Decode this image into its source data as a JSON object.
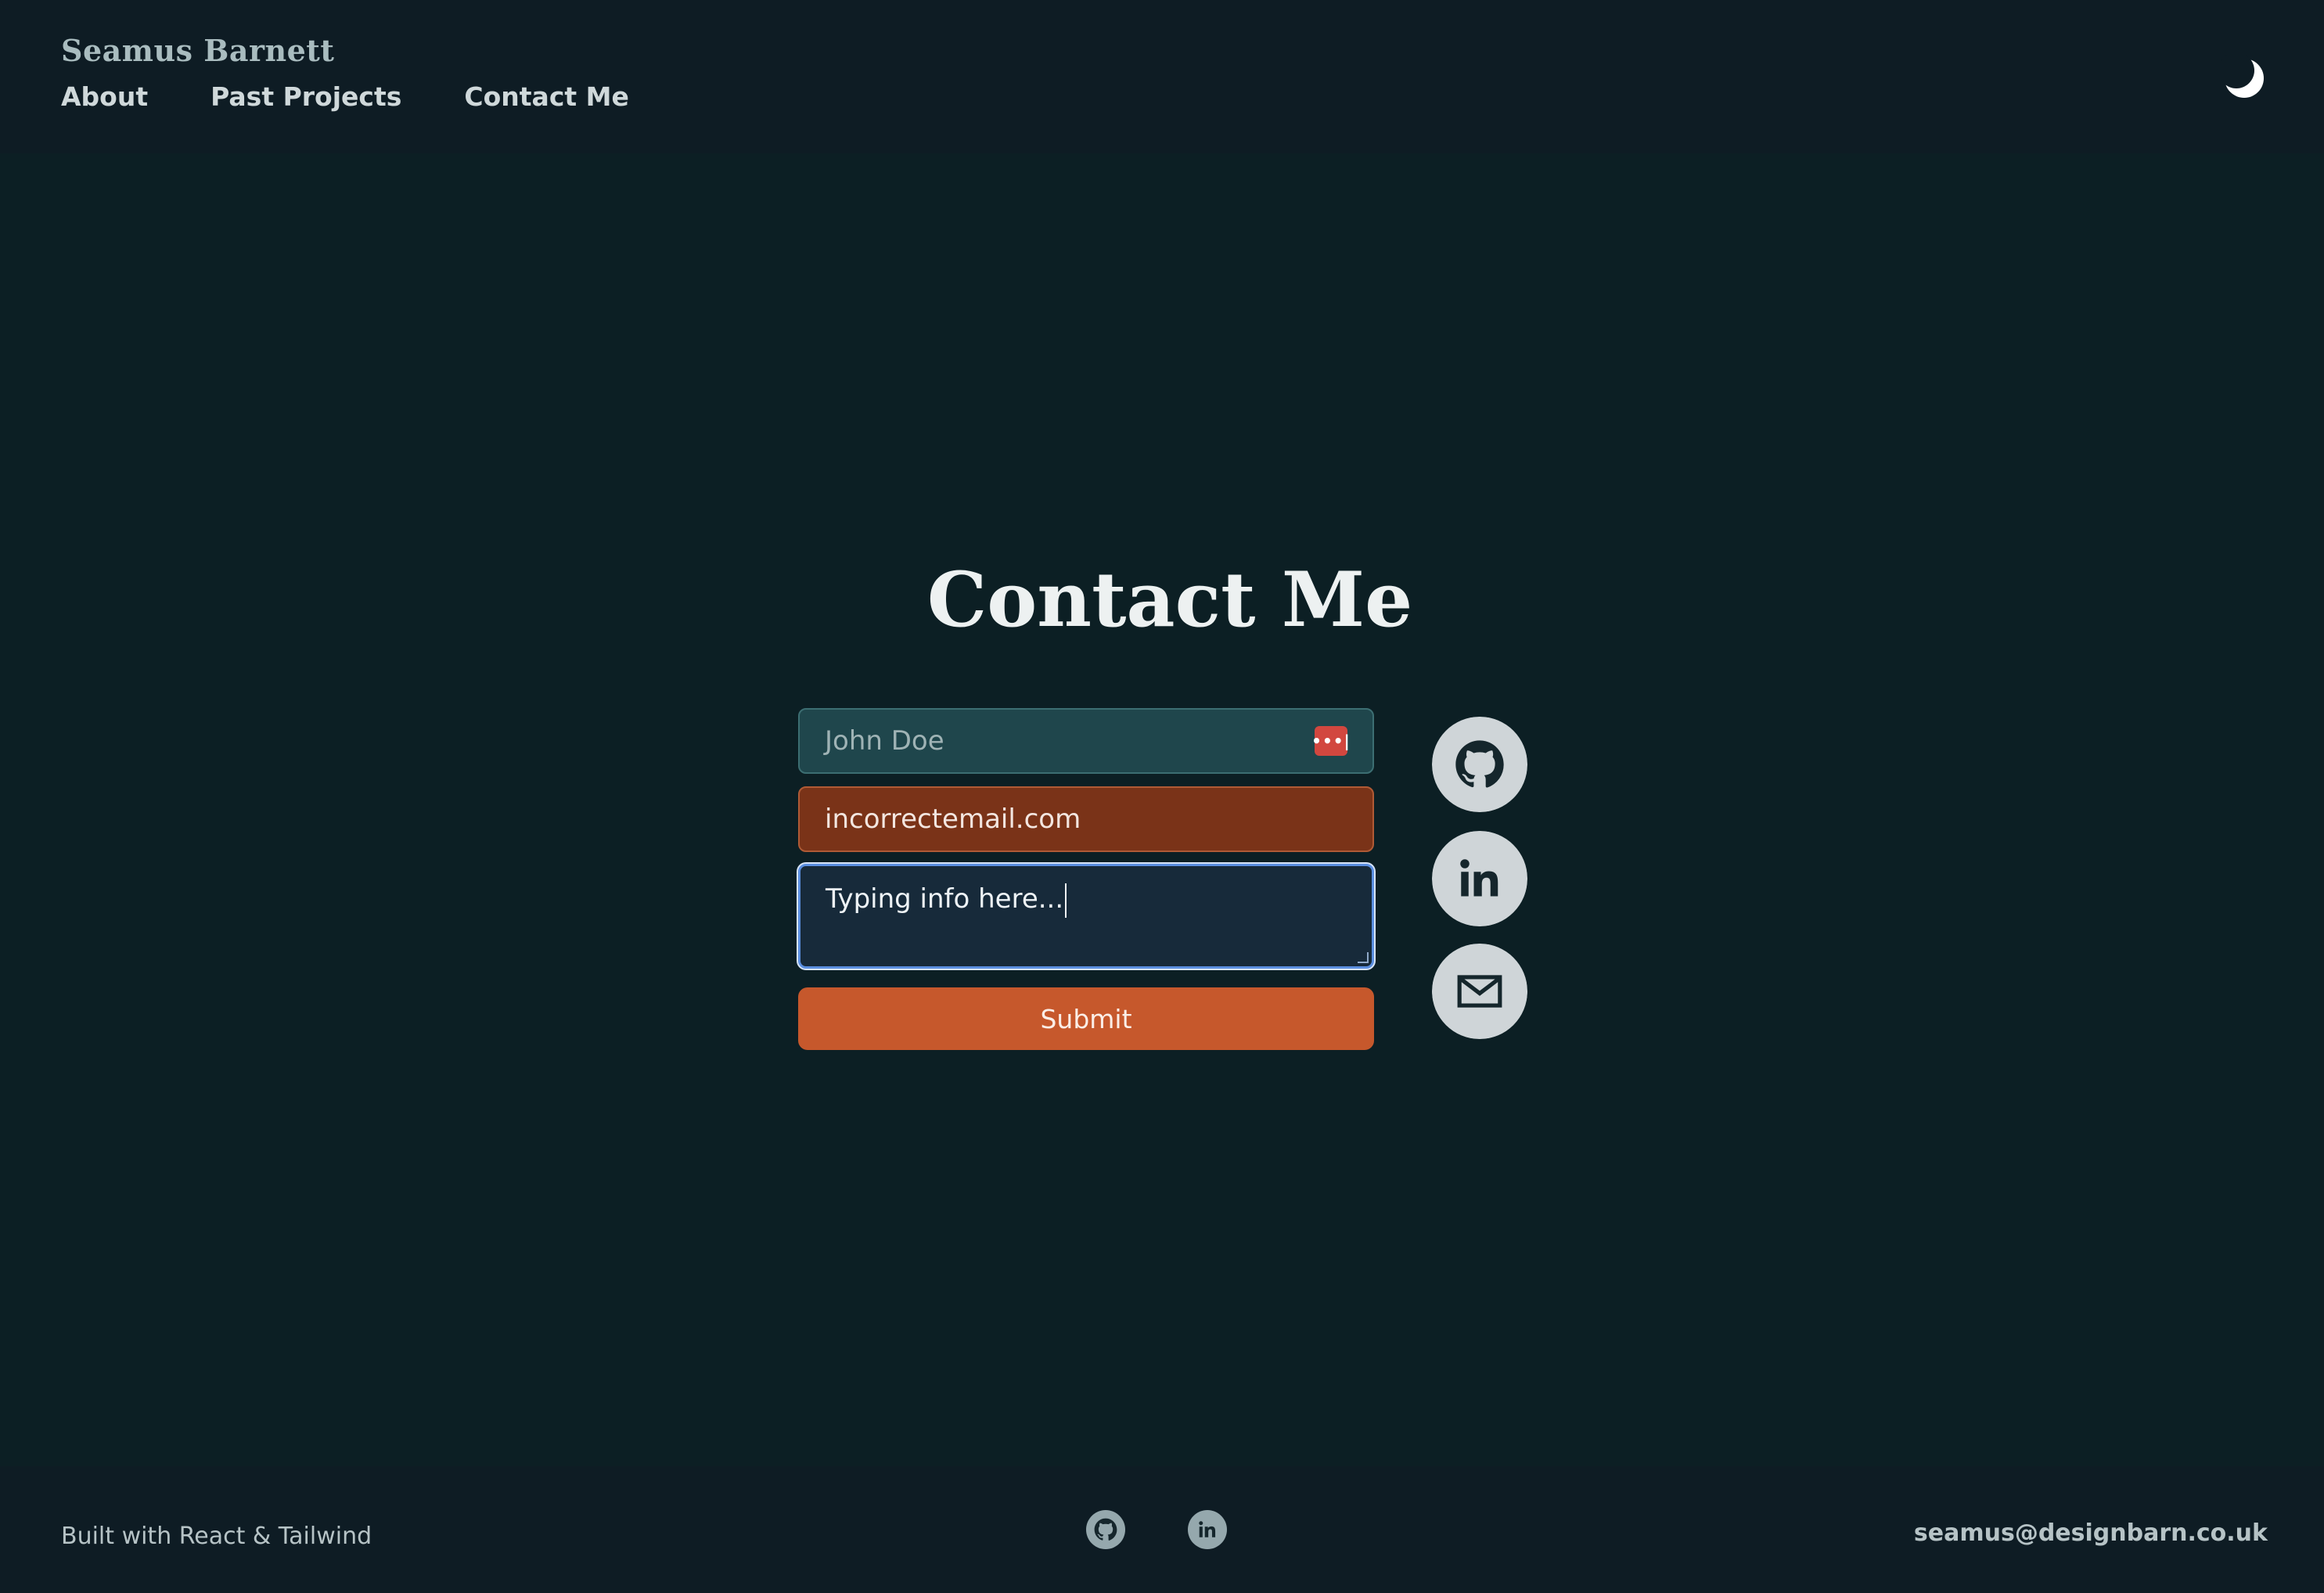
{
  "header": {
    "brand": "Seamus Barnett",
    "nav": [
      "About",
      "Past Projects",
      "Contact Me"
    ],
    "theme_icon": "moon-icon"
  },
  "main": {
    "title": "Contact Me",
    "form": {
      "name_placeholder": "John Doe",
      "email_value": "incorrectemail.com",
      "message_value": "Typing info here...",
      "submit_label": "Submit"
    },
    "social_icons": [
      "github-icon",
      "linkedin-icon",
      "mail-icon"
    ]
  },
  "footer": {
    "built_with": "Built with React & Tailwind",
    "icons": [
      "github-icon",
      "linkedin-icon"
    ],
    "email": "seamus@designbarn.co.uk"
  },
  "colors": {
    "background": "#0c1f24",
    "header_bg": "#0e1c24",
    "accent": "#c6582c",
    "error_field": "#7a3318",
    "focus_ring": "#5b8fe0"
  }
}
